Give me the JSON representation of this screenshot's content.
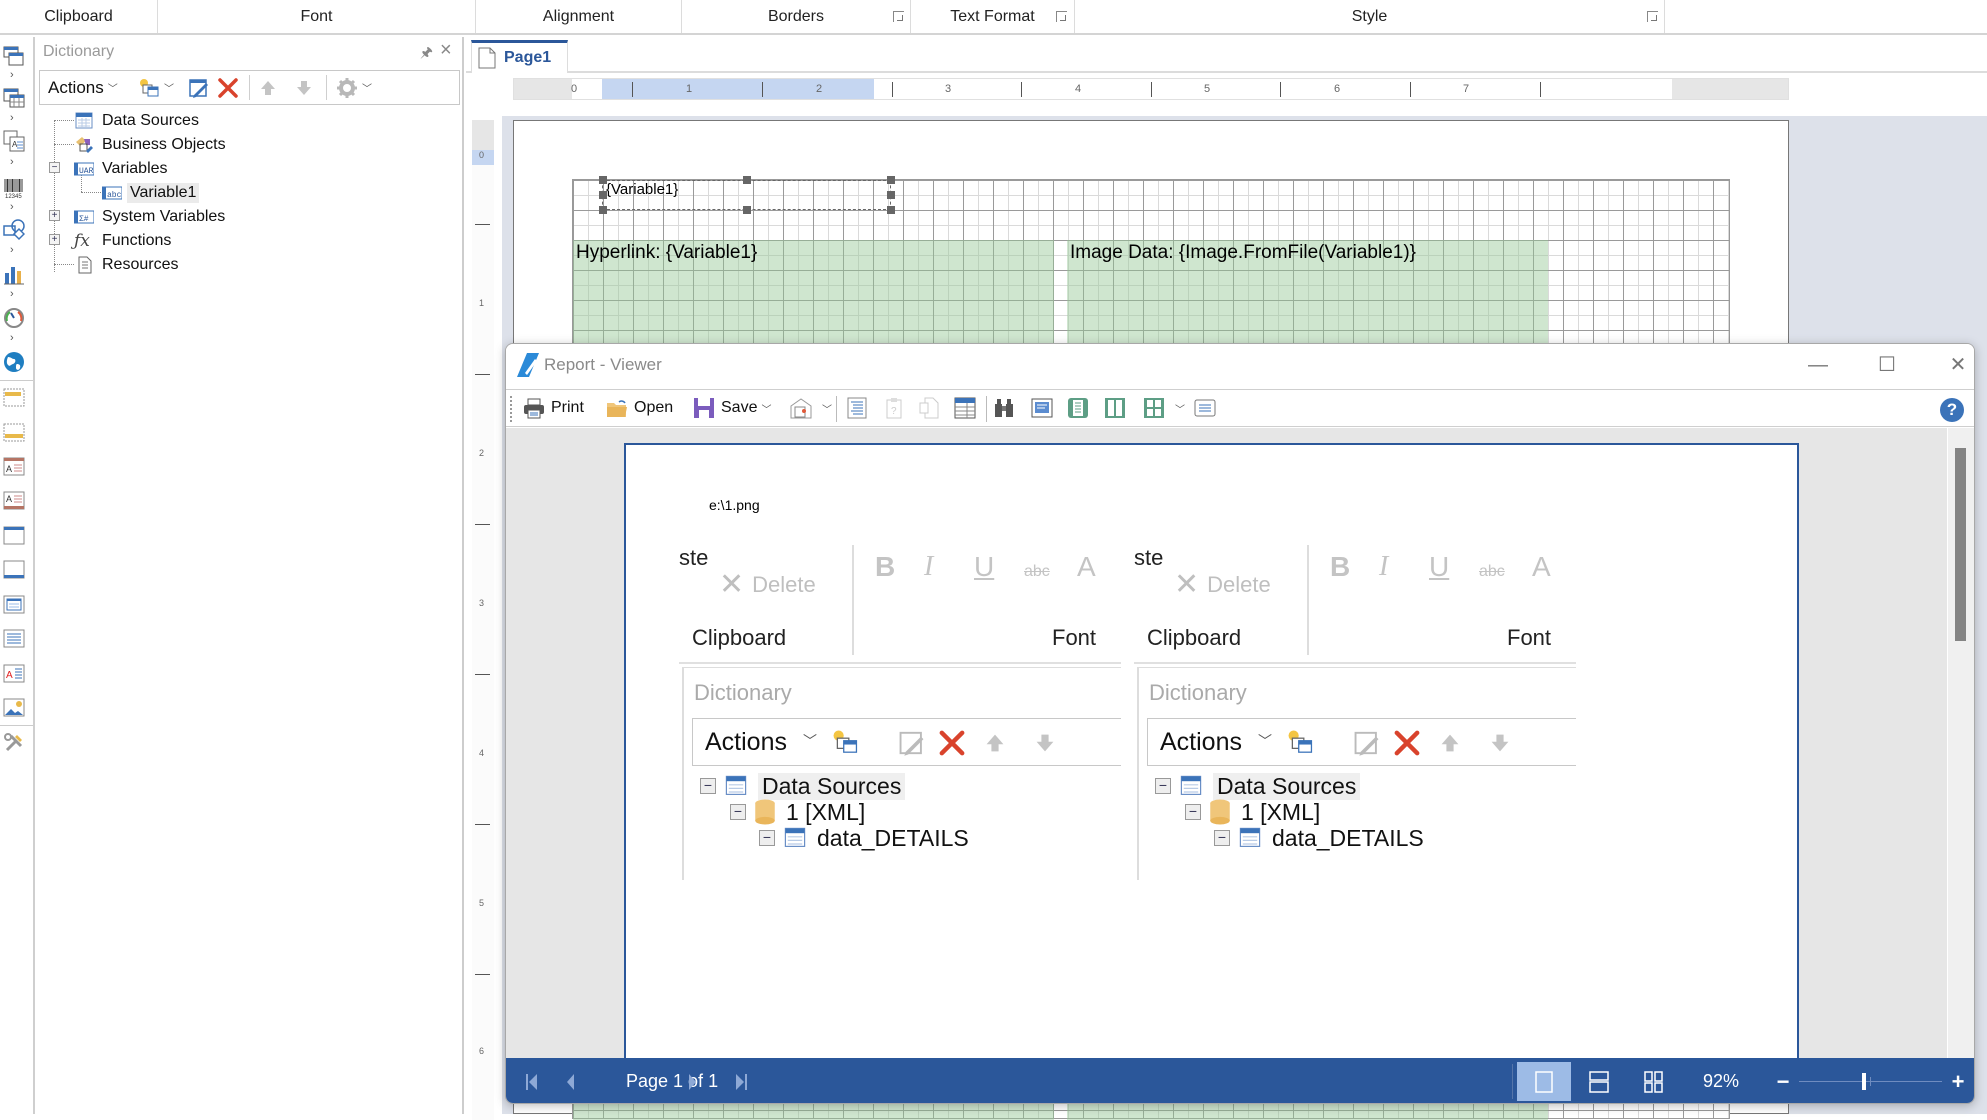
{
  "ribbon": {
    "groups": [
      {
        "label": "Clipboard",
        "launcher": false
      },
      {
        "label": "Font",
        "launcher": false
      },
      {
        "label": "Alignment",
        "launcher": false
      },
      {
        "label": "Borders",
        "launcher": true
      },
      {
        "label": "Text Format",
        "launcher": true
      },
      {
        "label": "Style",
        "launcher": true
      }
    ]
  },
  "toolstrip": {
    "icons": [
      "page-icon",
      "table-icon",
      "cross-tab-icon",
      "barcode-icon",
      "shapes-icon",
      "chart-icon",
      "gauge-icon",
      "map-icon",
      "report-title-band-icon",
      "report-summary-band-icon",
      "page-header-band-icon",
      "page-footer-band-icon",
      "group-header-band-icon",
      "group-footer-band-icon",
      "header-band-icon",
      "data-band-icon",
      "text-icon",
      "image-icon",
      "tools-icon"
    ]
  },
  "dictionary": {
    "title": "Dictionary",
    "toolbar": {
      "actions_label": "Actions"
    },
    "tree": [
      {
        "label": "Data Sources",
        "icon": "data-sources-icon",
        "expander": null,
        "level": 0
      },
      {
        "label": "Business Objects",
        "icon": "business-objects-icon",
        "expander": null,
        "level": 0
      },
      {
        "label": "Variables",
        "icon": "variables-icon",
        "expander": "minus",
        "level": 0
      },
      {
        "label": "Variable1",
        "icon": "string-variable-icon",
        "expander": null,
        "level": 1,
        "selected": true
      },
      {
        "label": "System Variables",
        "icon": "system-variables-icon",
        "expander": "plus",
        "level": 0
      },
      {
        "label": "Functions",
        "icon": "functions-icon",
        "expander": "plus",
        "level": 0
      },
      {
        "label": "Resources",
        "icon": "resources-icon",
        "expander": null,
        "level": 0
      }
    ]
  },
  "designer": {
    "page_tab": "Page1",
    "hruler": [
      "0",
      "1",
      "2",
      "3",
      "4",
      "5",
      "6",
      "7"
    ],
    "vruler": [
      "0",
      "1",
      "2",
      "3",
      "4",
      "5",
      "6"
    ],
    "components": {
      "variable_text": "{Variable1}",
      "hyperlink_text": "Hyperlink: {Variable1}",
      "image_text": "Image Data: {Image.FromFile(Variable1)}"
    }
  },
  "viewer": {
    "title": "Report - Viewer",
    "toolbar": {
      "print": "Print",
      "open": "Open",
      "save": "Save"
    },
    "page": {
      "path_text": "e:\\1.png",
      "snapshot": {
        "paste_fragment": "ste",
        "delete_label": "Delete",
        "clipboard_label": "Clipboard",
        "font_label": "Font",
        "format_buttons": [
          "B",
          "I",
          "U",
          "abc",
          "A"
        ],
        "dictionary_title": "Dictionary",
        "actions_label": "Actions",
        "tree": [
          {
            "label": "Data Sources",
            "level": 0
          },
          {
            "label": "1 [XML]",
            "level": 1
          },
          {
            "label": "data_DETAILS",
            "level": 2
          }
        ]
      }
    },
    "status": {
      "page_label": "Page 1 of 1",
      "zoom_label": "92%",
      "zoom_percent": 92
    }
  },
  "colors": {
    "accent": "#2b579a",
    "status_bar": "#2b579a",
    "component_fill": "#cfe5cf",
    "ruler_highlight": "#c5d6f1",
    "canvas_bg": "#dde1ea"
  }
}
